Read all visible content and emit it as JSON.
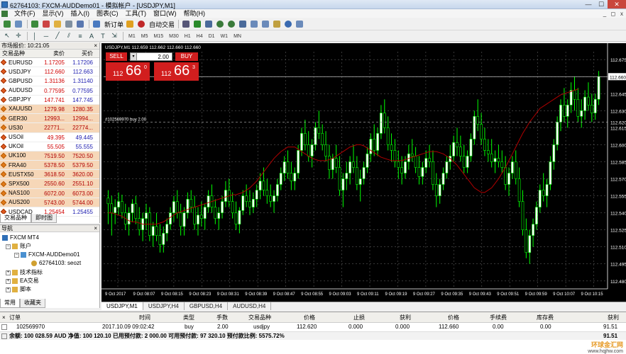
{
  "window": {
    "title": "62764103: FXCM-AUDDemo01 - 模拟帐户 - [USDJPY,M1]",
    "min_label": "—",
    "max_label": "☐",
    "close_label": "✕"
  },
  "menu": [
    "文件(F)",
    "显示(V)",
    "插入(I)",
    "图表(C)",
    "工具(T)",
    "窗口(W)",
    "帮助(H)"
  ],
  "mdi_controls": [
    "_",
    "◻",
    "x"
  ],
  "toolbar": {
    "new_order": "新订单",
    "autotrading": "自动交易",
    "timeframes": [
      "M1",
      "M5",
      "M15",
      "M30",
      "H1",
      "H4",
      "D1",
      "W1",
      "MN"
    ]
  },
  "market_watch": {
    "title": "市场报价: 10:21:05",
    "close": "×",
    "headers": {
      "symbol": "交易品种",
      "bid": "卖价",
      "ask": "买价"
    },
    "rows": [
      {
        "symbol": "EURUSD",
        "bid": "1.17205",
        "ask": "1.17206",
        "kind": "fx"
      },
      {
        "symbol": "USDJPY",
        "bid": "112.660",
        "ask": "112.663",
        "kind": "fx"
      },
      {
        "symbol": "GBPUSD",
        "bid": "1.31136",
        "ask": "1.31140",
        "kind": "fx"
      },
      {
        "symbol": "AUDUSD",
        "bid": "0.77595",
        "ask": "0.77595",
        "kind": "fx"
      },
      {
        "symbol": "GBPJPY",
        "bid": "147.741",
        "ask": "147.745",
        "kind": "fx"
      },
      {
        "symbol": "XAUUSD",
        "bid": "1279.98",
        "ask": "1280.35",
        "kind": "cfd"
      },
      {
        "symbol": "GER30",
        "bid": "12993...",
        "ask": "12994...",
        "kind": "cfd"
      },
      {
        "symbol": "US30",
        "bid": "22771...",
        "ask": "22774...",
        "kind": "cfd"
      },
      {
        "symbol": "USOil",
        "bid": "49.395",
        "ask": "49.445",
        "kind": "fx"
      },
      {
        "symbol": "UKOil",
        "bid": "55.505",
        "ask": "55.555",
        "kind": "fx"
      },
      {
        "symbol": "UK100",
        "bid": "7519.50",
        "ask": "7520.50",
        "kind": "cfd"
      },
      {
        "symbol": "FRA40",
        "bid": "5378.50",
        "ask": "5379.50",
        "kind": "cfd"
      },
      {
        "symbol": "EUSTX50",
        "bid": "3618.50",
        "ask": "3620.00",
        "kind": "cfd"
      },
      {
        "symbol": "SPX500",
        "bid": "2550.60",
        "ask": "2551.10",
        "kind": "cfd"
      },
      {
        "symbol": "NAS100",
        "bid": "6072.00",
        "ask": "6073.00",
        "kind": "cfd"
      },
      {
        "symbol": "AUS200",
        "bid": "5743.00",
        "ask": "5744.00",
        "kind": "cfd"
      },
      {
        "symbol": "USDCAD",
        "bid": "1.25454",
        "ask": "1.25455",
        "kind": "fx"
      }
    ],
    "tabs": [
      "交易品种",
      "即时图"
    ]
  },
  "navigator": {
    "title": "导航",
    "close": "×",
    "items": {
      "root": "FXCM MT4",
      "accounts": "账户",
      "server": "FXCM-AUDDemo01",
      "account": "62764103: seozt",
      "indicators": "技术指标",
      "ea": "EA交易",
      "scripts": "脚本"
    },
    "tabs": [
      "常用",
      "收藏夹"
    ]
  },
  "chart": {
    "info_label": "USDJPY,M1  112.659 112.662 112.660 112.660",
    "order_line_label": "#102569970 buy 2.00",
    "tabs": [
      "USDJPY,M1",
      "USDJPY,H4",
      "GBPUSD,H4",
      "AUDUSD,H4"
    ],
    "colors": {
      "up": "#ffffff",
      "down": "#000000",
      "wick": "#00ff00",
      "ma": "#b00000",
      "grid": "#5a5a5a"
    }
  },
  "oneclick": {
    "sell_label": "SELL",
    "buy_label": "BUY",
    "lot": "2.00",
    "sell_price_small": "112",
    "sell_price_big": "66",
    "sell_price_sup": "0",
    "buy_price_small": "112",
    "buy_price_big": "66",
    "buy_price_sup": "3"
  },
  "chart_data": {
    "type": "candlestick",
    "symbol": "USDJPY",
    "timeframe": "M1",
    "y_ticks": [
      "112.675",
      "112.660",
      "112.645",
      "112.630",
      "112.615",
      "112.600",
      "112.585",
      "112.570",
      "112.555",
      "112.540",
      "112.525",
      "112.510",
      "112.495",
      "112.480"
    ],
    "x_ticks": [
      "9 Oct 2017",
      "9 Oct 08:07",
      "9 Oct 08:15",
      "9 Oct 08:23",
      "9 Oct 08:31",
      "9 Oct 08:39",
      "9 Oct 08:47",
      "9 Oct 08:55",
      "9 Oct 09:03",
      "9 Oct 09:11",
      "9 Oct 09:19",
      "9 Oct 09:27",
      "9 Oct 09:35",
      "9 Oct 09:43",
      "9 Oct 09:51",
      "9 Oct 09:59",
      "9 Oct 10:07",
      "9 Oct 10:15"
    ],
    "ylim": [
      112.473,
      112.682
    ],
    "price_line": 112.66,
    "order_line": 112.62,
    "candles": [
      [
        112.553,
        112.56,
        112.53,
        112.548
      ],
      [
        112.548,
        112.555,
        112.52,
        112.54
      ],
      [
        112.54,
        112.552,
        112.53,
        112.545
      ],
      [
        112.545,
        112.558,
        112.538,
        112.55
      ],
      [
        112.55,
        112.556,
        112.535,
        112.54
      ],
      [
        112.54,
        112.548,
        112.525,
        112.53
      ],
      [
        112.53,
        112.545,
        112.52,
        112.54
      ],
      [
        112.54,
        112.552,
        112.532,
        112.548
      ],
      [
        112.548,
        112.555,
        112.53,
        112.535
      ],
      [
        112.535,
        112.545,
        112.52,
        112.525
      ],
      [
        112.525,
        112.54,
        112.515,
        112.535
      ],
      [
        112.535,
        112.548,
        112.525,
        112.54
      ],
      [
        112.54,
        112.545,
        112.515,
        112.52
      ],
      [
        112.52,
        112.532,
        112.51,
        112.528
      ],
      [
        112.528,
        112.54,
        112.515,
        112.52
      ],
      [
        112.52,
        112.53,
        112.505,
        112.512
      ],
      [
        112.512,
        112.528,
        112.505,
        112.522
      ],
      [
        112.522,
        112.535,
        112.515,
        112.53
      ],
      [
        112.53,
        112.545,
        112.525,
        112.54
      ],
      [
        112.54,
        112.555,
        112.532,
        112.55
      ],
      [
        112.55,
        112.56,
        112.535,
        112.54
      ],
      [
        112.54,
        112.548,
        112.52,
        112.528
      ],
      [
        112.528,
        112.545,
        112.52,
        112.54
      ],
      [
        112.54,
        112.558,
        112.535,
        112.552
      ],
      [
        112.552,
        112.56,
        112.54,
        112.545
      ],
      [
        112.545,
        112.555,
        112.525,
        112.53
      ],
      [
        112.53,
        112.545,
        112.52,
        112.538
      ],
      [
        112.538,
        112.55,
        112.528,
        112.535
      ],
      [
        112.535,
        112.548,
        112.525,
        112.545
      ],
      [
        112.545,
        112.56,
        112.54,
        112.555
      ],
      [
        112.555,
        112.565,
        112.54,
        112.545
      ],
      [
        112.545,
        112.552,
        112.53,
        112.535
      ],
      [
        112.535,
        112.545,
        112.525,
        112.54
      ],
      [
        112.54,
        112.555,
        112.535,
        112.55
      ],
      [
        112.55,
        112.568,
        112.545,
        112.56
      ],
      [
        112.56,
        112.57,
        112.545,
        112.55
      ],
      [
        112.55,
        112.558,
        112.535,
        112.54
      ],
      [
        112.54,
        112.55,
        112.525,
        112.53
      ],
      [
        112.53,
        112.545,
        112.522,
        112.542
      ],
      [
        112.542,
        112.56,
        112.538,
        112.555
      ],
      [
        112.555,
        112.565,
        112.545,
        112.55
      ],
      [
        112.55,
        112.56,
        112.538,
        112.545
      ],
      [
        112.545,
        112.558,
        112.54,
        112.552
      ],
      [
        112.552,
        112.565,
        112.545,
        112.56
      ],
      [
        112.56,
        112.575,
        112.552,
        112.568
      ],
      [
        112.568,
        112.58,
        112.555,
        112.56
      ],
      [
        112.56,
        112.57,
        112.548,
        112.555
      ],
      [
        112.555,
        112.565,
        112.545,
        112.55
      ],
      [
        112.55,
        112.56,
        112.54,
        112.555
      ],
      [
        112.555,
        112.57,
        112.55,
        112.565
      ],
      [
        112.565,
        112.58,
        112.56,
        112.575
      ],
      [
        112.575,
        112.59,
        112.568,
        112.585
      ],
      [
        112.585,
        112.595,
        112.57,
        112.575
      ],
      [
        112.575,
        112.585,
        112.56,
        112.568
      ],
      [
        112.568,
        112.58,
        112.56,
        112.575
      ],
      [
        112.575,
        112.6,
        112.57,
        112.595
      ],
      [
        112.595,
        112.615,
        112.59,
        112.61
      ],
      [
        112.61,
        112.622,
        112.595,
        112.6
      ],
      [
        112.6,
        112.612,
        112.585,
        112.59
      ],
      [
        112.59,
        112.605,
        112.58,
        112.6
      ],
      [
        112.6,
        112.62,
        112.595,
        112.615
      ],
      [
        112.615,
        112.63,
        112.605,
        112.61
      ],
      [
        112.61,
        112.618,
        112.595,
        112.6
      ],
      [
        112.6,
        112.612,
        112.585,
        112.59
      ],
      [
        112.59,
        112.6,
        112.57,
        112.578
      ],
      [
        112.578,
        112.592,
        112.57,
        112.588
      ],
      [
        112.588,
        112.6,
        112.575,
        112.58
      ],
      [
        112.58,
        112.59,
        112.555,
        112.56
      ],
      [
        112.56,
        112.575,
        112.545,
        112.57
      ],
      [
        112.57,
        112.585,
        112.56,
        112.575
      ],
      [
        112.575,
        112.59,
        112.565,
        112.585
      ],
      [
        112.585,
        112.6,
        112.575,
        112.58
      ],
      [
        112.58,
        112.59,
        112.56,
        112.565
      ],
      [
        112.565,
        112.578,
        112.55,
        112.57
      ],
      [
        112.57,
        112.585,
        112.565,
        112.58
      ],
      [
        112.58,
        112.598,
        112.575,
        112.592
      ],
      [
        112.592,
        112.61,
        112.585,
        112.605
      ],
      [
        112.605,
        112.618,
        112.59,
        112.595
      ],
      [
        112.595,
        112.615,
        112.59,
        112.61
      ],
      [
        112.61,
        112.635,
        112.605,
        112.628
      ],
      [
        112.628,
        112.64,
        112.61,
        112.615
      ],
      [
        112.615,
        112.625,
        112.595,
        112.6
      ],
      [
        112.6,
        112.61,
        112.585,
        112.595
      ],
      [
        112.595,
        112.605,
        112.58,
        112.585
      ],
      [
        112.585,
        112.595,
        112.57,
        112.58
      ],
      [
        112.58,
        112.59,
        112.565,
        112.575
      ],
      [
        112.575,
        112.59,
        112.57,
        112.585
      ],
      [
        112.585,
        112.6,
        112.578,
        112.592
      ],
      [
        112.592,
        112.605,
        112.585,
        112.59
      ],
      [
        112.59,
        112.598,
        112.575,
        112.58
      ],
      [
        112.58,
        112.59,
        112.565,
        112.572
      ],
      [
        112.572,
        112.585,
        112.565,
        112.58
      ],
      [
        112.58,
        112.595,
        112.575,
        112.588
      ],
      [
        112.588,
        112.6,
        112.58,
        112.585
      ],
      [
        112.585,
        112.595,
        112.56,
        112.565
      ],
      [
        112.565,
        112.575,
        112.545,
        112.555
      ],
      [
        112.555,
        112.57,
        112.548,
        112.565
      ],
      [
        112.565,
        112.58,
        112.56,
        112.575
      ],
      [
        112.575,
        112.59,
        112.57,
        112.585
      ],
      [
        112.585,
        112.6,
        112.578,
        112.59
      ],
      [
        112.59,
        112.608,
        112.585,
        112.602
      ],
      [
        112.602,
        112.615,
        112.59,
        112.598
      ],
      [
        112.598,
        112.608,
        112.585,
        112.59
      ],
      [
        112.59,
        112.6,
        112.575,
        112.58
      ],
      [
        112.58,
        112.595,
        112.575,
        112.59
      ],
      [
        112.59,
        112.61,
        112.585,
        112.605
      ],
      [
        112.605,
        112.63,
        112.6,
        112.625
      ],
      [
        112.625,
        112.64,
        112.612,
        112.618
      ],
      [
        112.618,
        112.628,
        112.6,
        112.605
      ],
      [
        112.605,
        112.615,
        112.59,
        112.595
      ],
      [
        112.595,
        112.605,
        112.585,
        112.592
      ],
      [
        112.592,
        112.605,
        112.58,
        112.585
      ],
      [
        112.585,
        112.595,
        112.575,
        112.588
      ],
      [
        112.588,
        112.6,
        112.58,
        112.585
      ],
      [
        112.585,
        112.595,
        112.575,
        112.58
      ],
      [
        112.58,
        112.59,
        112.56,
        112.565
      ],
      [
        112.565,
        112.58,
        112.555,
        112.575
      ],
      [
        112.575,
        112.59,
        112.57,
        112.585
      ],
      [
        112.585,
        112.595,
        112.565,
        112.57
      ],
      [
        112.57,
        112.58,
        112.545,
        112.55
      ],
      [
        112.55,
        112.56,
        112.52,
        112.525
      ],
      [
        112.525,
        112.535,
        112.5,
        112.505
      ],
      [
        112.505,
        112.525,
        112.495,
        112.52
      ],
      [
        112.52,
        112.535,
        112.51,
        112.53
      ],
      [
        112.53,
        112.55,
        112.525,
        112.545
      ],
      [
        112.545,
        112.565,
        112.54,
        112.56
      ],
      [
        112.56,
        112.575,
        112.55,
        112.555
      ],
      [
        112.555,
        112.57,
        112.545,
        112.565
      ],
      [
        112.565,
        112.59,
        112.56,
        112.585
      ],
      [
        112.585,
        112.605,
        112.578,
        112.6
      ],
      [
        112.6,
        112.625,
        112.595,
        112.62
      ],
      [
        112.62,
        112.64,
        112.612,
        112.635
      ],
      [
        112.635,
        112.65,
        112.62,
        112.625
      ],
      [
        112.625,
        112.64,
        112.615,
        112.635
      ],
      [
        112.635,
        112.655,
        112.628,
        112.648
      ],
      [
        112.648,
        112.66,
        112.63,
        112.64
      ],
      [
        112.64,
        112.65,
        112.62,
        112.625
      ],
      [
        112.625,
        112.64,
        112.615,
        112.63
      ],
      [
        112.63,
        112.648,
        112.622,
        112.642
      ],
      [
        112.642,
        112.655,
        112.63,
        112.635
      ],
      [
        112.635,
        112.645,
        112.62,
        112.628
      ],
      [
        112.628,
        112.645,
        112.622,
        112.64
      ],
      [
        112.64,
        112.665,
        112.635,
        112.66
      ]
    ],
    "ma": [
      112.54,
      112.54,
      112.539,
      112.538,
      112.537,
      112.535,
      112.533,
      112.532,
      112.532,
      112.531,
      112.53,
      112.53,
      112.53,
      112.53,
      112.53,
      112.531,
      112.532,
      112.534,
      112.536,
      112.538,
      112.54,
      112.541,
      112.542,
      112.543,
      112.544,
      112.545,
      112.546,
      112.547,
      112.548,
      112.549,
      112.55,
      112.551,
      112.552,
      112.553,
      112.554,
      112.555,
      112.556,
      112.556,
      112.557,
      112.558,
      112.56,
      112.562,
      112.565,
      112.568,
      112.572,
      112.576,
      112.58,
      112.584,
      112.588,
      112.591,
      112.594,
      112.596,
      112.598,
      112.598,
      112.598,
      112.596,
      112.594,
      112.592,
      112.59,
      112.588,
      112.587,
      112.586,
      112.586,
      112.586,
      112.587,
      112.588,
      112.59,
      112.592,
      112.594,
      112.596,
      112.598,
      112.599,
      112.6,
      112.6,
      112.599,
      112.597,
      112.595,
      112.593,
      112.591,
      112.589,
      112.588,
      112.587,
      112.586,
      112.586,
      112.586,
      112.586,
      112.587,
      112.588,
      112.589,
      112.59,
      112.591,
      112.592,
      112.593,
      112.594,
      112.594,
      112.594,
      112.593,
      112.592,
      112.59,
      112.588,
      112.585,
      112.582,
      112.578,
      112.574,
      112.57,
      112.566,
      112.562,
      112.56,
      112.558,
      112.558,
      112.56,
      112.562,
      112.566,
      112.57,
      112.575,
      112.58,
      112.586,
      112.592,
      112.598,
      112.604,
      112.61,
      112.615,
      112.62,
      112.624,
      112.628,
      112.632,
      112.634,
      112.636,
      112.638,
      112.64,
      112.642,
      112.644,
      112.645,
      112.646,
      112.647,
      112.648,
      112.649
    ]
  },
  "terminal": {
    "headers": {
      "order": "订单",
      "time": "时间",
      "type": "类型",
      "volume": "手数",
      "symbol": "交易品种",
      "price": "价格",
      "sl": "止损",
      "tp": "获利",
      "price2": "价格",
      "commission": "手续费",
      "swap": "库存费",
      "profit": "获利"
    },
    "close": "×",
    "order_row": {
      "order": "102569970",
      "time": "2017.10.09 09:02:42",
      "type": "buy",
      "volume": "2.00",
      "symbol": "usdjpy",
      "price": "112.620",
      "sl": "0.000",
      "tp": "0.000",
      "price2": "112.660",
      "commission": "0.00",
      "swap": "0.00",
      "profit": "91.51"
    },
    "balance_text": "余额: 100 028.59 AUD  净值: 100 120.10  已用预付款: 2 000.00  可用预付款: 97 320.10  预付款比例: 5575.72%",
    "balance_profit": "91.51"
  },
  "watermark": {
    "logo_text": "环球金汇网",
    "url": "www.hqjhw.com"
  }
}
